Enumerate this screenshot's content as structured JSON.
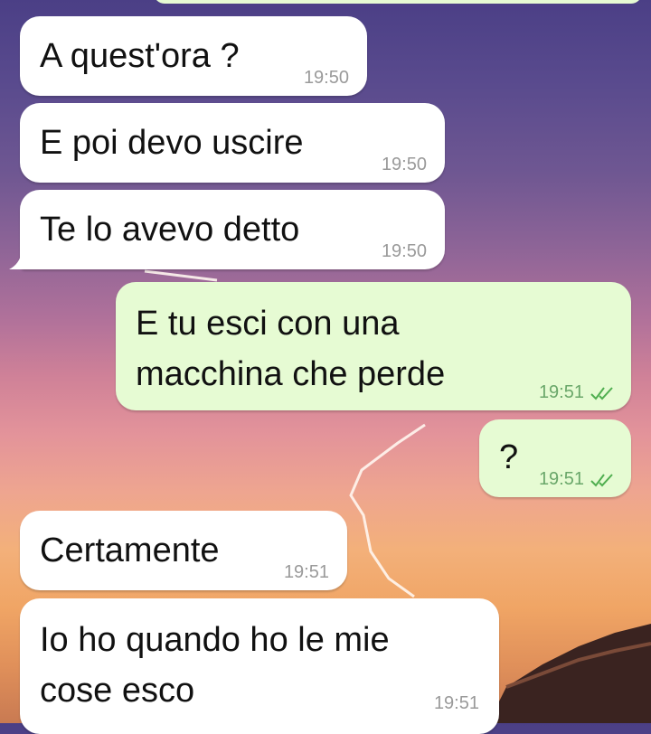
{
  "messages": [
    {
      "text": "A quest'ora ?",
      "time": "19:50"
    },
    {
      "text": "E poi devo uscire",
      "time": "19:50"
    },
    {
      "text": "Te lo avevo detto",
      "time": "19:50"
    },
    {
      "text": "E tu esci con una\nmacchina che perde",
      "time": "19:51"
    },
    {
      "text": "?",
      "time": "19:51"
    },
    {
      "text": "Certamente",
      "time": "19:51"
    },
    {
      "text": "Io ho quando ho le mie\ncose esco",
      "time": "19:51"
    }
  ],
  "colors": {
    "incoming_bubble": "#ffffff",
    "outgoing_bubble": "#e6fbd3",
    "read_ticks": "#4fae4f"
  }
}
